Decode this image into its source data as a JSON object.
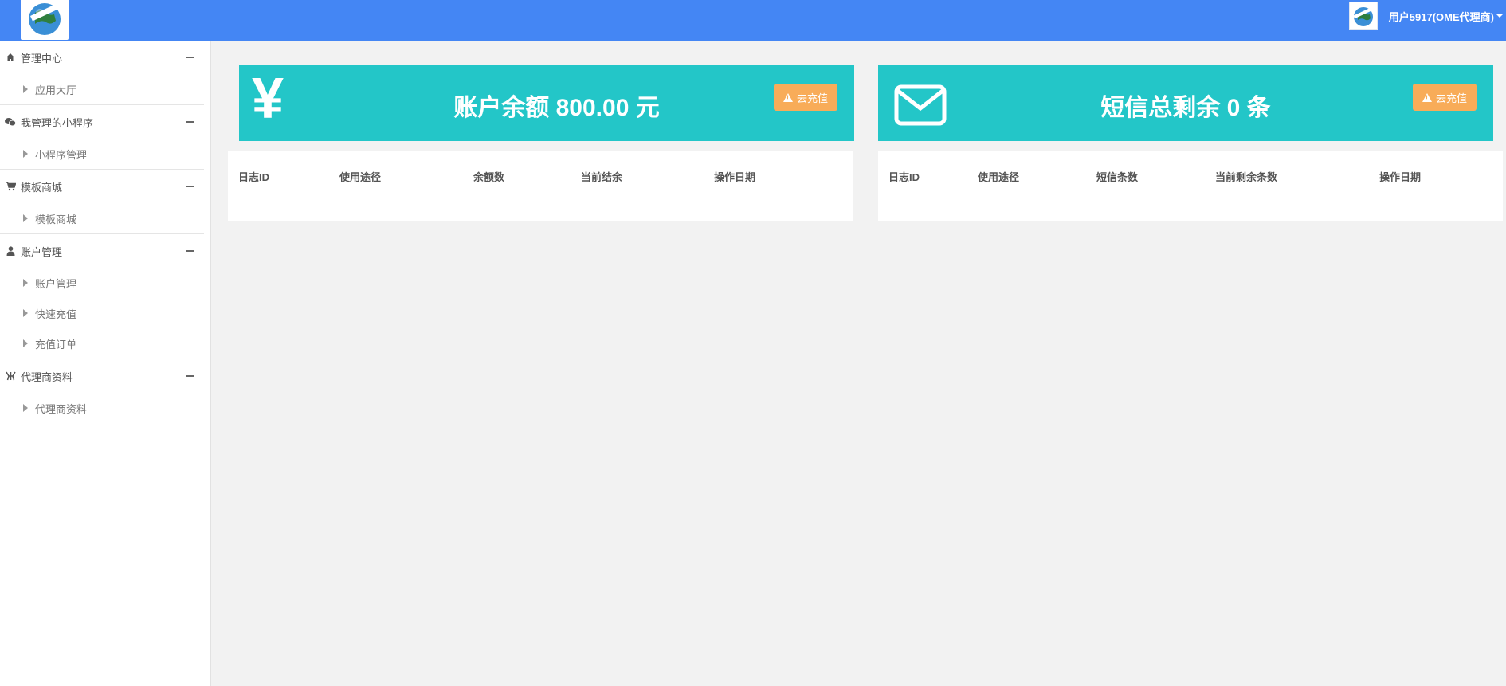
{
  "header": {
    "user_label": "用户5917(OME代理商)"
  },
  "sidebar": {
    "groups": [
      {
        "icon": "home-icon",
        "label": "管理中心",
        "items": [
          "应用大厅"
        ]
      },
      {
        "icon": "wechat-icon",
        "label": "我管理的小程序",
        "items": [
          "小程序管理"
        ]
      },
      {
        "icon": "cart-icon",
        "label": "模板商城",
        "items": [
          "模板商城"
        ]
      },
      {
        "icon": "user-icon",
        "label": "账户管理",
        "items": [
          "账户管理",
          "快速充值",
          "充值订单"
        ]
      },
      {
        "icon": "agent-icon",
        "label": "代理商资料",
        "items": [
          "代理商资料"
        ]
      }
    ]
  },
  "balance_card": {
    "icon": "yen-icon",
    "symbol": "¥",
    "title": "账户余额 800.00 元",
    "button": "去充值"
  },
  "sms_card": {
    "icon": "envelope-icon",
    "title": "短信总剩余 0 条",
    "button": "去充值"
  },
  "balance_table": {
    "columns": [
      "日志ID",
      "使用途径",
      "余额数",
      "当前结余",
      "操作日期"
    ]
  },
  "sms_table": {
    "columns": [
      "日志ID",
      "使用途径",
      "短信条数",
      "当前剩余条数",
      "操作日期"
    ]
  },
  "colors": {
    "topbar": "#4486f4",
    "card": "#23c6c8",
    "button": "#f8ac59"
  }
}
